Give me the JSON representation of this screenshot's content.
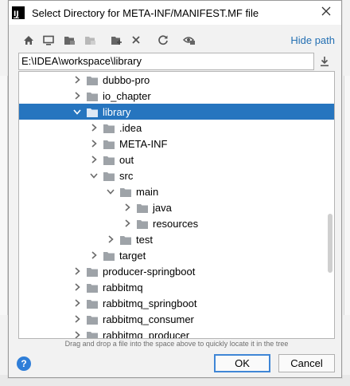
{
  "dialog": {
    "title": "Select Directory for META-INF/MANIFEST.MF file",
    "logo_text": "IJ"
  },
  "toolbar": {
    "icons": [
      "home-icon",
      "desktop-icon",
      "project-icon",
      "module-icon",
      "new-folder-icon",
      "delete-icon",
      "refresh-icon",
      "show-hidden-icon"
    ],
    "hide_path_label": "Hide path"
  },
  "path": {
    "value": "E:\\IDEA\\workspace\\library"
  },
  "tree": {
    "items": [
      {
        "label": "dubbo-pro",
        "level": 0,
        "expanded": false,
        "selected": false
      },
      {
        "label": "io_chapter",
        "level": 0,
        "expanded": false,
        "selected": false
      },
      {
        "label": "library",
        "level": 0,
        "expanded": true,
        "selected": true
      },
      {
        "label": ".idea",
        "level": 1,
        "expanded": false,
        "selected": false
      },
      {
        "label": "META-INF",
        "level": 1,
        "expanded": false,
        "selected": false
      },
      {
        "label": "out",
        "level": 1,
        "expanded": false,
        "selected": false
      },
      {
        "label": "src",
        "level": 1,
        "expanded": true,
        "selected": false
      },
      {
        "label": "main",
        "level": 2,
        "expanded": true,
        "selected": false
      },
      {
        "label": "java",
        "level": 3,
        "expanded": false,
        "selected": false
      },
      {
        "label": "resources",
        "level": 3,
        "expanded": false,
        "selected": false
      },
      {
        "label": "test",
        "level": 2,
        "expanded": false,
        "selected": false
      },
      {
        "label": "target",
        "level": 1,
        "expanded": false,
        "selected": false
      },
      {
        "label": "producer-springboot",
        "level": 0,
        "expanded": false,
        "selected": false
      },
      {
        "label": "rabbitmq",
        "level": 0,
        "expanded": false,
        "selected": false
      },
      {
        "label": "rabbitmq_springboot",
        "level": 0,
        "expanded": false,
        "selected": false
      },
      {
        "label": "rabbitmq_consumer",
        "level": 0,
        "expanded": false,
        "selected": false
      },
      {
        "label": "rabbitmq_producer",
        "level": 0,
        "expanded": false,
        "selected": false
      }
    ]
  },
  "hint": "Drag and drop a file into the space above to quickly locate it in the tree",
  "buttons": {
    "help": "?",
    "ok": "OK",
    "cancel": "Cancel"
  },
  "colors": {
    "selection": "#2675bf",
    "link": "#2470b3",
    "folder": "#9ea3a8"
  }
}
